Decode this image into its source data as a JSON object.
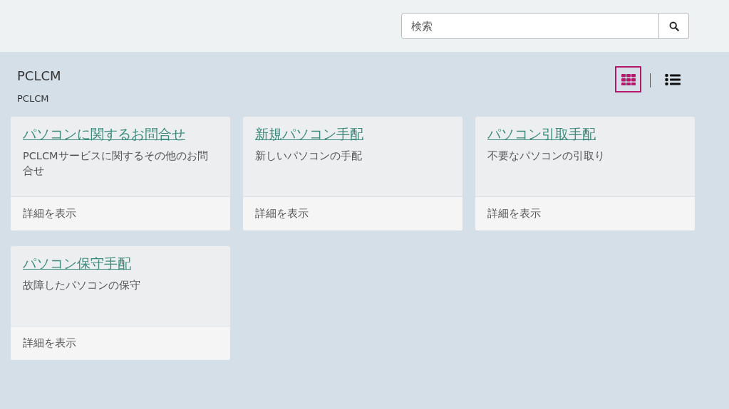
{
  "search": {
    "placeholder": "検索"
  },
  "header": {
    "title": "PCLCM",
    "subtitle": "PCLCM"
  },
  "view_toggle": [
    {
      "kind": "grid",
      "selected": true
    },
    {
      "kind": "list",
      "selected": false
    }
  ],
  "cards": [
    {
      "title": "パソコンに関するお問合せ",
      "description": "PCLCMサービスに関するその他のお問合せ",
      "footer": "詳細を表示"
    },
    {
      "title": "新規パソコン手配",
      "description": "新しいパソコンの手配",
      "footer": "詳細を表示"
    },
    {
      "title": "パソコン引取手配",
      "description": "不要なパソコンの引取り",
      "footer": "詳細を表示"
    },
    {
      "title": "パソコン保守手配",
      "description": "故障したパソコンの保守",
      "footer": "詳細を表示"
    }
  ]
}
